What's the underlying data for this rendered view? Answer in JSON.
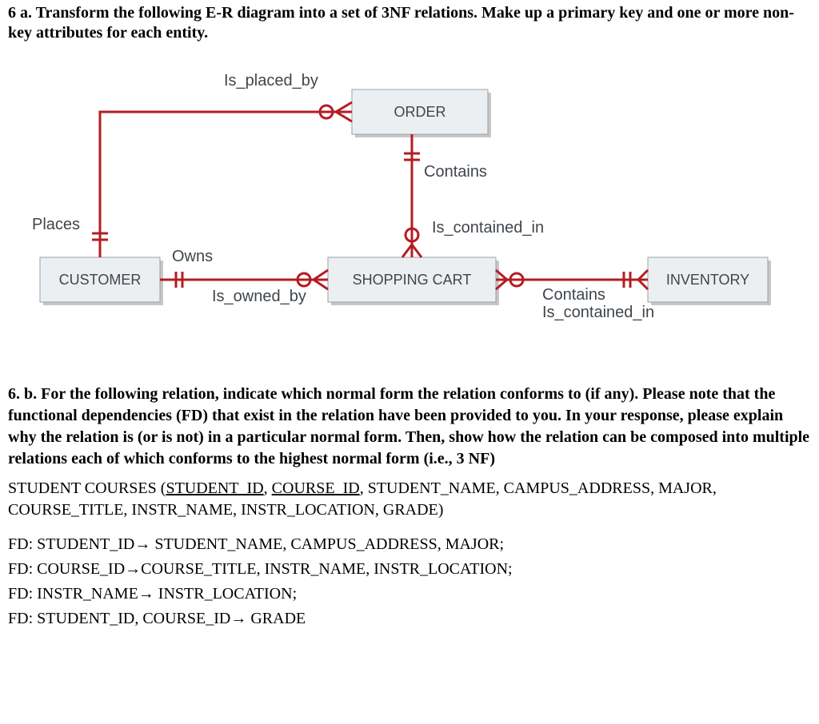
{
  "q6a": "6 a. Transform the following E-R diagram into a set of 3NF relations.  Make up a primary key and one or more non-key attributes for each entity.",
  "erd": {
    "entities": {
      "order": "ORDER",
      "customer": "CUSTOMER",
      "cart": "SHOPPING CART",
      "inventory": "INVENTORY"
    },
    "labels": {
      "is_placed_by": "Is_placed_by",
      "places": "Places",
      "owns": "Owns",
      "is_owned_by": "Is_owned_by",
      "contains_top": "Contains",
      "is_contained_in_top": "Is_contained_in",
      "contains_right": "Contains",
      "is_contained_in_right": "Is_contained_in"
    }
  },
  "q6b": "6. b. For the following relation, indicate which normal form the relation conforms to (if any). Please note that the functional dependencies (FD) that exist in the relation have been provided to you. In your response, please explain why the relation is (or is not) in a particular normal form. Then, show how the relation can be composed into multiple relations each of which conforms to the highest normal form (i.e., 3 NF)",
  "relation": {
    "name": "STUDENT COURSES",
    "pk1": "STUDENT_ID",
    "pk2": "COURSE_ID",
    "rest": ", STUDENT_NAME, CAMPUS_ADDRESS, MAJOR, COURSE_TITLE, INSTR_NAME, INSTR_LOCATION, GRADE)"
  },
  "fds": {
    "l1": "FD: STUDENT_ID→ STUDENT_NAME, CAMPUS_ADDRESS, MAJOR;",
    "l2": "FD: COURSE_ID→COURSE_TITLE, INSTR_NAME, INSTR_LOCATION;",
    "l3": "FD: INSTR_NAME→ INSTR_LOCATION;",
    "l4": "FD: STUDENT_ID, COURSE_ID→ GRADE"
  }
}
